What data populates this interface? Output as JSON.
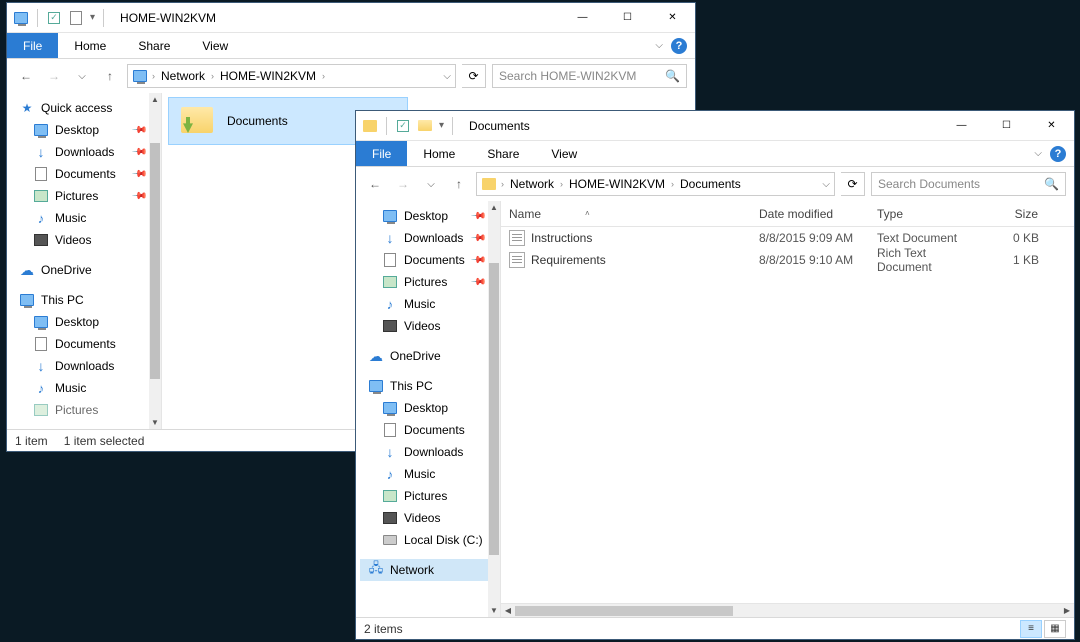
{
  "window1": {
    "title": "HOME-WIN2KVM",
    "tabs": {
      "file": "File",
      "home": "Home",
      "share": "Share",
      "view": "View"
    },
    "breadcrumbs": [
      "Network",
      "HOME-WIN2KVM"
    ],
    "search_placeholder": "Search HOME-WIN2KVM",
    "nav": {
      "quick_access": "Quick access",
      "desktop": "Desktop",
      "downloads": "Downloads",
      "documents": "Documents",
      "pictures": "Pictures",
      "music": "Music",
      "videos": "Videos",
      "onedrive": "OneDrive",
      "this_pc": "This PC",
      "pc_desktop": "Desktop",
      "pc_documents": "Documents",
      "pc_downloads": "Downloads",
      "pc_music": "Music",
      "pc_pictures": "Pictures"
    },
    "content": {
      "folder": "Documents"
    },
    "status": {
      "count": "1 item",
      "selected": "1 item selected"
    }
  },
  "window2": {
    "title": "Documents",
    "tabs": {
      "file": "File",
      "home": "Home",
      "share": "Share",
      "view": "View"
    },
    "breadcrumbs": [
      "Network",
      "HOME-WIN2KVM",
      "Documents"
    ],
    "search_placeholder": "Search Documents",
    "nav": {
      "desktop": "Desktop",
      "downloads": "Downloads",
      "documents": "Documents",
      "pictures": "Pictures",
      "music": "Music",
      "videos": "Videos",
      "onedrive": "OneDrive",
      "this_pc": "This PC",
      "pc_desktop": "Desktop",
      "pc_documents": "Documents",
      "pc_downloads": "Downloads",
      "pc_music": "Music",
      "pc_pictures": "Pictures",
      "pc_videos": "Videos",
      "pc_localdisk": "Local Disk (C:)",
      "network": "Network"
    },
    "columns": {
      "name": "Name",
      "date": "Date modified",
      "type": "Type",
      "size": "Size"
    },
    "files": [
      {
        "name": "Instructions",
        "date": "8/8/2015 9:09 AM",
        "type": "Text Document",
        "size": "0 KB"
      },
      {
        "name": "Requirements",
        "date": "8/8/2015 9:10 AM",
        "type": "Rich Text Document",
        "size": "1 KB"
      }
    ],
    "status": {
      "count": "2 items"
    }
  }
}
